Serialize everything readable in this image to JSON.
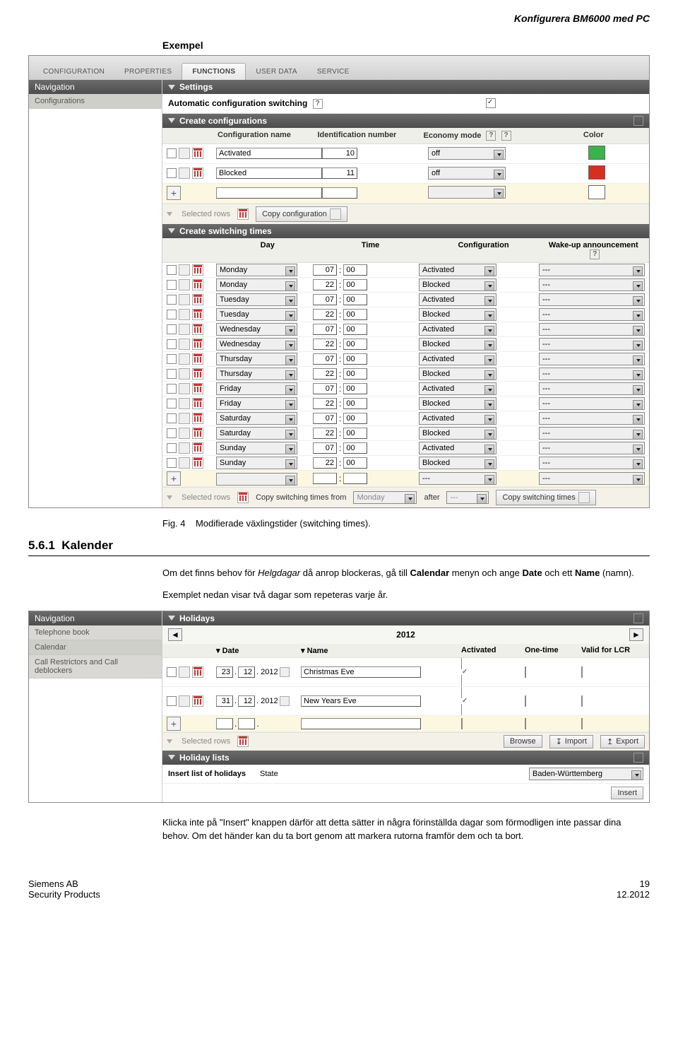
{
  "header_title": "Konfigurera BM6000 med PC",
  "example_label": "Exempel",
  "figure_caption": {
    "num": "Fig. 4",
    "text": "Modifierade växlingstider (switching times)."
  },
  "section": {
    "num": "5.6.1",
    "title": "Kalender"
  },
  "para1": "Om det finns behov för Helgdagar då anrop blockeras, gå till Calendar menyn och ange Date och ett Name (namn).",
  "para2": "Exemplet nedan visar två dagar som repeteras varje år.",
  "para3": "Klicka inte på \"Insert\" knappen därför att detta sätter in några förinställda dagar som förmodligen inte passar dina behov. Om det händer kan du ta bort genom att markera rutorna framför dem och ta bort.",
  "footer": {
    "company": "Siemens AB",
    "dept": "Security Products",
    "page": "19",
    "date": "12.2012"
  },
  "shot1": {
    "tabs": [
      "CONFIGURATION",
      "PROPERTIES",
      "FUNCTIONS",
      "USER DATA",
      "SERVICE"
    ],
    "active_tab": "FUNCTIONS",
    "sidebar": {
      "title": "Navigation",
      "items": [
        "Configurations"
      ]
    },
    "settings": {
      "title": "Settings",
      "auto_switch_label": "Automatic configuration switching",
      "auto_switch_checked": true
    },
    "create_cfg": {
      "title": "Create configurations",
      "cols": [
        "Configuration name",
        "Identification number",
        "Economy mode",
        "Color"
      ],
      "rows": [
        {
          "name": "Activated",
          "id": "10",
          "econ": "off",
          "color": "#3bb24a"
        },
        {
          "name": "Blocked",
          "id": "11",
          "econ": "off",
          "color": "#d62f1f"
        }
      ],
      "selected_rows_label": "Selected rows",
      "copy_btn": "Copy configuration"
    },
    "switch_times": {
      "title": "Create switching times",
      "cols": [
        "Day",
        "Time",
        "Configuration",
        "Wake-up announcement"
      ],
      "rows": [
        {
          "day": "Monday",
          "h": "07",
          "m": "00",
          "cfg": "Activated",
          "wake": "---"
        },
        {
          "day": "Monday",
          "h": "22",
          "m": "00",
          "cfg": "Blocked",
          "wake": "---"
        },
        {
          "day": "Tuesday",
          "h": "07",
          "m": "00",
          "cfg": "Activated",
          "wake": "---"
        },
        {
          "day": "Tuesday",
          "h": "22",
          "m": "00",
          "cfg": "Blocked",
          "wake": "---"
        },
        {
          "day": "Wednesday",
          "h": "07",
          "m": "00",
          "cfg": "Activated",
          "wake": "---"
        },
        {
          "day": "Wednesday",
          "h": "22",
          "m": "00",
          "cfg": "Blocked",
          "wake": "---"
        },
        {
          "day": "Thursday",
          "h": "07",
          "m": "00",
          "cfg": "Activated",
          "wake": "---"
        },
        {
          "day": "Thursday",
          "h": "22",
          "m": "00",
          "cfg": "Blocked",
          "wake": "---"
        },
        {
          "day": "Friday",
          "h": "07",
          "m": "00",
          "cfg": "Activated",
          "wake": "---"
        },
        {
          "day": "Friday",
          "h": "22",
          "m": "00",
          "cfg": "Blocked",
          "wake": "---"
        },
        {
          "day": "Saturday",
          "h": "07",
          "m": "00",
          "cfg": "Activated",
          "wake": "---"
        },
        {
          "day": "Saturday",
          "h": "22",
          "m": "00",
          "cfg": "Blocked",
          "wake": "---"
        },
        {
          "day": "Sunday",
          "h": "07",
          "m": "00",
          "cfg": "Activated",
          "wake": "---"
        },
        {
          "day": "Sunday",
          "h": "22",
          "m": "00",
          "cfg": "Blocked",
          "wake": "---"
        }
      ],
      "blank": {
        "day": "",
        "h": "",
        "m": "",
        "cfg": "---",
        "wake": "---"
      },
      "footer": {
        "selected": "Selected rows",
        "copy_from": "Copy switching times from",
        "from_day": "Monday",
        "after_label": "after",
        "after_val": "---",
        "copy_btn": "Copy switching times"
      }
    }
  },
  "shot2": {
    "sidebar": {
      "title": "Navigation",
      "items": [
        "Telephone book",
        "Calendar",
        "Call Restrictors and Call deblockers"
      ],
      "active": "Calendar"
    },
    "holidays": {
      "title": "Holidays",
      "year": "2012",
      "cols": [
        "Date",
        "Name",
        "Activated",
        "One-time",
        "Valid for LCR"
      ],
      "rows": [
        {
          "d": "23",
          "m": "12",
          "y": "2012",
          "name": "Christmas Eve",
          "act": true,
          "one": false,
          "lcr": false
        },
        {
          "d": "31",
          "m": "12",
          "y": "2012",
          "name": "New Years Eve",
          "act": true,
          "one": false,
          "lcr": false
        }
      ],
      "footer": {
        "selected": "Selected rows",
        "browse": "Browse",
        "import": "Import",
        "export": "Export"
      }
    },
    "holiday_lists": {
      "title": "Holiday lists",
      "insert_label": "Insert list of holidays",
      "state_label": "State",
      "state_value": "Baden-Württemberg",
      "insert_btn": "Insert"
    }
  }
}
